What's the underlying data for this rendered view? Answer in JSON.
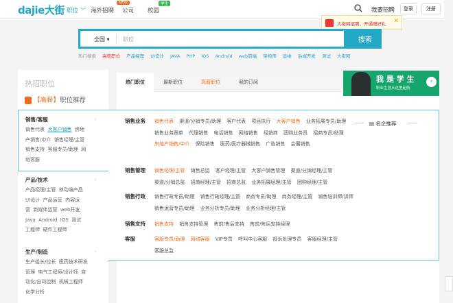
{
  "header": {
    "logo": "dajie大街",
    "nav": [
      {
        "label": "职位 ﹀"
      },
      {
        "label": "海外招聘",
        "badge": "NEW"
      },
      {
        "label": "公司"
      },
      {
        "label": "校园",
        "badge": "学生"
      }
    ],
    "hire_link": "我要招聘",
    "login": "登录",
    "register": "注册",
    "promo_text": "大街网招聘，开通赠好礼",
    "promo_close": "✕"
  },
  "search": {
    "city": "全国 ▾",
    "placeholder": "职位",
    "button": "搜索",
    "hot_label": "热门搜索",
    "hot_keywords": [
      "高薪职位",
      "产品经理",
      "UI设计",
      "JAVA",
      "PHP",
      "IOS",
      "Android",
      "web前端",
      "架构师",
      "运维",
      "后端开发",
      "测试",
      "大街网"
    ]
  },
  "left": {
    "title": "热招职位",
    "subtitle_red": "【高薪】",
    "subtitle_gray": "职位推荐",
    "categories": [
      {
        "name": "销售/客服",
        "items": [
          "销售代表",
          "大客户销售",
          "房地",
          "产销售/中介",
          "销售经理/主管",
          "销售支持",
          "客服专员/助理",
          "网",
          "络客服"
        ]
      },
      {
        "name": "产品/技术",
        "items": [
          "产品经理/主管",
          "移动端产品",
          "UI设计",
          "产品运营",
          "内容运",
          "营",
          "新媒体运营",
          "web开发",
          "Java",
          "Android",
          "IOS",
          "测试",
          "工程师",
          "硬件工程师"
        ]
      },
      {
        "name": "生产/制造",
        "items": [
          "生产组长/拉长",
          "医药技术研发",
          "管理",
          "电气工程师/设计师",
          "自",
          "动化/自动控制",
          "机械工程师",
          "化学分析"
        ]
      }
    ]
  },
  "tabs": [
    "热门职位",
    "最新职位",
    "高薪职位",
    "我的订阅"
  ],
  "banner": {
    "title": "我 是 学 生",
    "subtitle": "职业生涯从这里起航",
    "arrow": "›"
  },
  "dropdown": {
    "recommend": "名企推荐",
    "sections": [
      {
        "name": "销售业务",
        "items": [
          [
            "销售代表",
            "o"
          ],
          [
            "渠道/分销专员/助理",
            ""
          ],
          [
            "客户代表",
            ""
          ],
          [
            "项目执行",
            ""
          ],
          [
            "大客户销售",
            "o"
          ],
          [
            "业务拓展专员/助理",
            ""
          ],
          [
            "销售业务跟单",
            ""
          ],
          [
            "代理销售",
            ""
          ],
          [
            "电话销售",
            ""
          ],
          [
            "网络销售",
            ""
          ],
          [
            "经销商",
            ""
          ],
          [
            "团购业务员",
            ""
          ],
          [
            "招商专员/助理",
            ""
          ],
          [
            "房地产销售/中介",
            "o"
          ],
          [
            "保险销售",
            ""
          ],
          [
            "医药/医疗器械销售",
            ""
          ],
          [
            "广告销售",
            ""
          ],
          [
            "会展销售",
            ""
          ]
        ]
      },
      {
        "name": "销售管理",
        "items": [
          [
            "销售经理/主管",
            "o"
          ],
          [
            "销售总监",
            ""
          ],
          [
            "客户经理/主管",
            ""
          ],
          [
            "大客户销售管理",
            ""
          ],
          [
            "渠道/分销经理/主管",
            ""
          ],
          [
            "渠道/分销总监",
            ""
          ],
          [
            "招商经理/主管",
            ""
          ],
          [
            "招商总监",
            ""
          ],
          [
            "业务拓展经理/主管",
            ""
          ],
          [
            "团购经理/主管",
            ""
          ]
        ]
      },
      {
        "name": "销售行政",
        "items": [
          [
            "销售行政专员/助理",
            ""
          ],
          [
            "销售行政经理/主管",
            ""
          ],
          [
            "商务专员/助理",
            ""
          ],
          [
            "商务经理/主管",
            ""
          ],
          [
            "销售培训师/讲师",
            ""
          ],
          [
            "销售运营专员/助理",
            ""
          ],
          [
            "业务分析专员/助理",
            ""
          ],
          [
            "业务分析经理/主管",
            ""
          ]
        ]
      },
      {
        "name": "销售支持",
        "items": [
          [
            "销售支持",
            "o"
          ],
          [
            "销售支持管理",
            ""
          ],
          [
            "售前/售后支持",
            ""
          ],
          [
            "售前/售后支持经理",
            ""
          ]
        ]
      },
      {
        "name": "客服",
        "items": [
          [
            "客服专员/助理",
            "o"
          ],
          [
            "网络客服",
            "o"
          ],
          [
            "VIP专员",
            ""
          ],
          [
            "呼叫中心客服",
            ""
          ],
          [
            "投诉处理专员",
            ""
          ],
          [
            "客服经理/主管",
            ""
          ],
          [
            "客服总监",
            ""
          ]
        ]
      }
    ]
  }
}
